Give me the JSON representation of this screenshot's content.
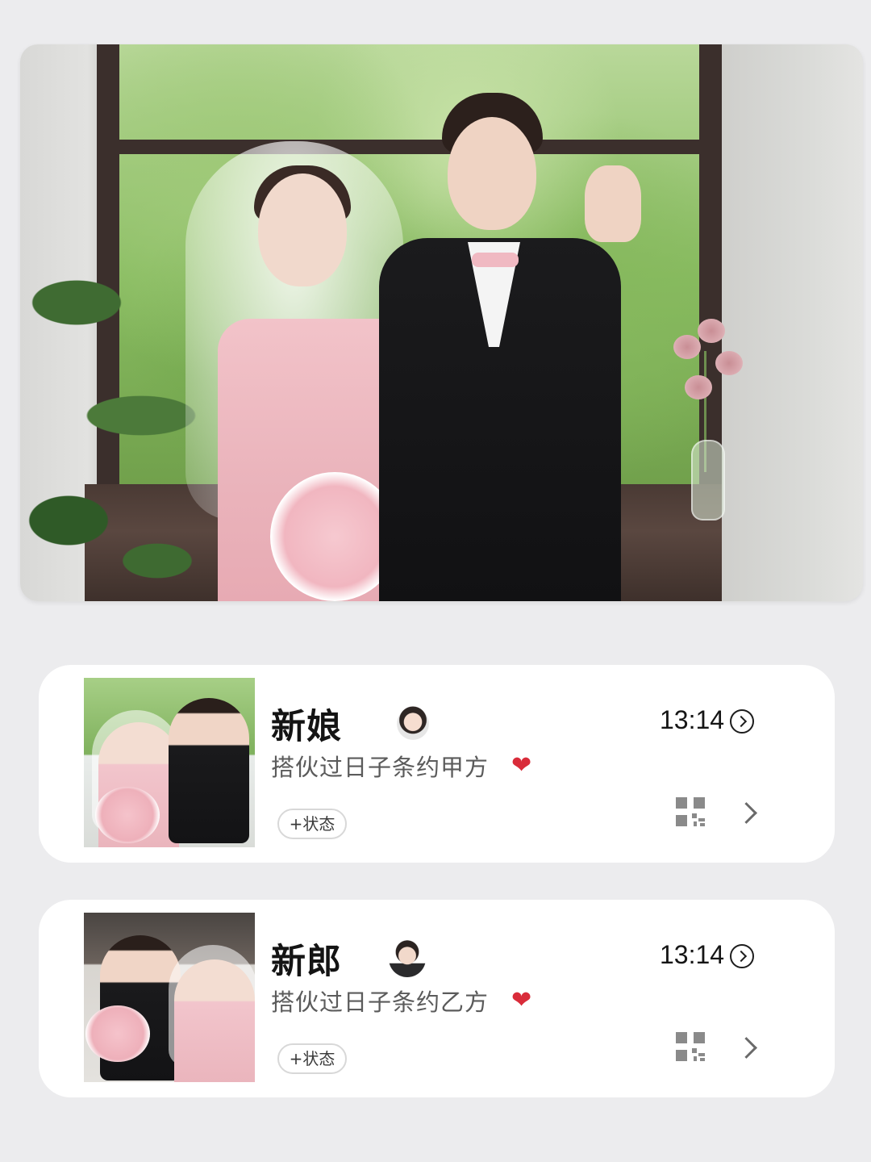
{
  "hero": {
    "image_alt": "wedding photo of bride and groom"
  },
  "profiles": [
    {
      "name": "新娘",
      "name_icon": "bride-with-veil-emoji",
      "signature": "搭伙过日子条约甲方",
      "signature_icon": "red-heart-emoji",
      "heart": "❤",
      "status_button": "+状态",
      "time": "13:14",
      "time_icon": "circle-arrow-right-icon",
      "qr_icon": "qr-code-icon",
      "chevron_icon": "chevron-right-icon"
    },
    {
      "name": "新郎",
      "name_icon": "groom-in-tuxedo-emoji",
      "signature": "搭伙过日子条约乙方",
      "signature_icon": "red-heart-emoji",
      "heart": "❤",
      "status_button": "+状态",
      "time": "13:14",
      "time_icon": "circle-arrow-right-icon",
      "qr_icon": "qr-code-icon",
      "chevron_icon": "chevron-right-icon"
    }
  ],
  "colors": {
    "page_background": "#ececee",
    "card_background": "#ffffff",
    "signature_text": "#5b5b5b",
    "heart": "#d92c3a"
  }
}
